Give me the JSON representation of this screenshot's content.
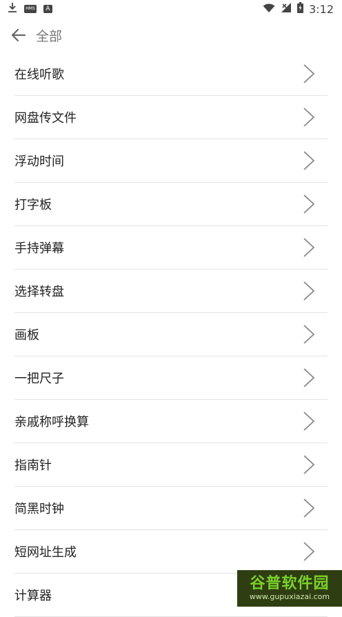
{
  "status_bar": {
    "time": "3:12",
    "left_icons": [
      "download-icon",
      "hms-icon",
      "a-icon"
    ],
    "hms_text": "HMS",
    "a_text": "A",
    "right_icons": [
      "wifi-icon",
      "signal-icon",
      "battery-icon"
    ]
  },
  "header": {
    "title": "全部"
  },
  "items": [
    {
      "label": "在线听歌"
    },
    {
      "label": "网盘传文件"
    },
    {
      "label": "浮动时间"
    },
    {
      "label": "打字板"
    },
    {
      "label": "手持弹幕"
    },
    {
      "label": "选择转盘"
    },
    {
      "label": "画板"
    },
    {
      "label": "一把尺子"
    },
    {
      "label": "亲戚称呼换算"
    },
    {
      "label": "指南针"
    },
    {
      "label": "简黑时钟"
    },
    {
      "label": "短网址生成"
    },
    {
      "label": "计算器"
    }
  ],
  "watermark": {
    "main": "谷普软件园",
    "sub": "www.gupuxiazai.com"
  }
}
